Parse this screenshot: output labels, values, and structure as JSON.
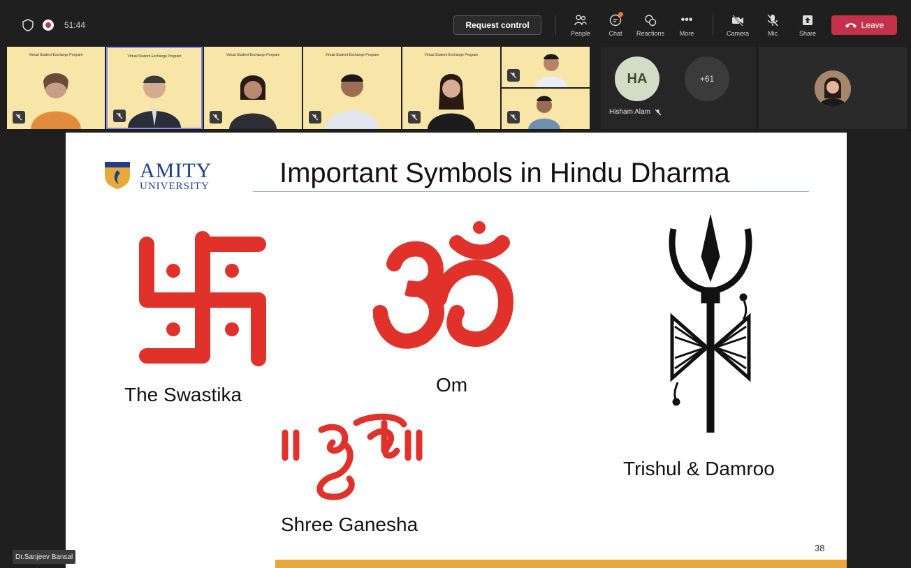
{
  "meeting": {
    "timer": "51:44",
    "request_control_label": "Request control",
    "toolbar": [
      {
        "label": "People",
        "icon": "people-icon"
      },
      {
        "label": "Chat",
        "icon": "chat-icon"
      },
      {
        "label": "Reactions",
        "icon": "reactions-icon"
      },
      {
        "label": "More",
        "icon": "more-icon"
      },
      {
        "label": "Camera",
        "icon": "camera-off-icon"
      },
      {
        "label": "Mic",
        "icon": "mic-off-icon"
      },
      {
        "label": "Share",
        "icon": "share-icon"
      }
    ],
    "leave_label": "Leave",
    "colors": {
      "leave": "#c4314b",
      "accent_dot": "#e8743b"
    }
  },
  "participants": {
    "hisham_initials": "HA",
    "hisham_name": "Hisham Alam",
    "overflow_count": "+61"
  },
  "presenter_name": "Dr.Sanjeev Bansal",
  "slide": {
    "logo_line1": "AMITY",
    "logo_line2": "UNIVERSITY",
    "title": "Important Symbols in Hindu Dharma",
    "symbols": {
      "swastika": "The Swastika",
      "om": "Om",
      "ganesha": "Shree Ganesha",
      "trishul": "Trishul & Damroo"
    },
    "page_number": "38",
    "colors": {
      "symbol_red": "#e0312b",
      "footer": "#e8a93a",
      "logo_blue": "#1f3f8a"
    }
  }
}
